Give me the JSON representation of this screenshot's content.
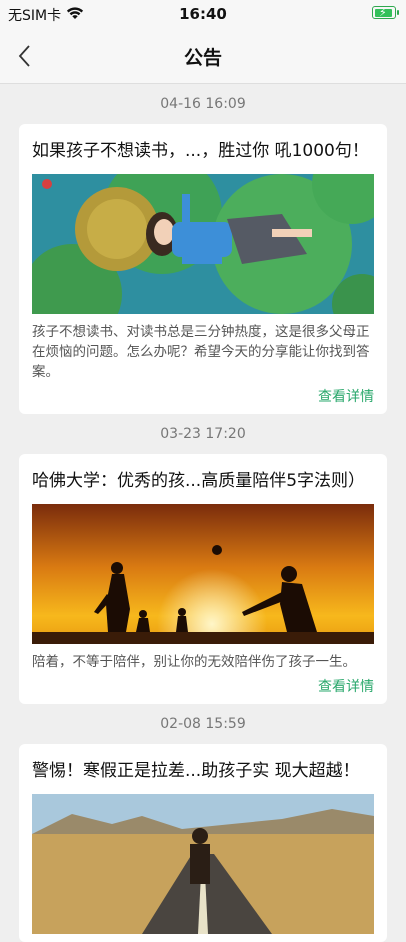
{
  "status_bar": {
    "carrier": "无SIM卡",
    "time": "16:40",
    "icons": [
      "wifi-icon",
      "battery-charging-icon"
    ],
    "battery_color": "#33c05a"
  },
  "nav": {
    "title": "公告",
    "back_icon": "chevron-left-icon"
  },
  "accent_color": "#2aa86c",
  "announcements": [
    {
      "time": "04-16 16:09",
      "title": "如果孩子不想读书，...，胜过你  吼1000句！",
      "image": "girl-lying-on-lily-pads-illustration",
      "description": "孩子不想读书、对读书总是三分钟热度，这是很多父母正在烦恼的问题。怎么办呢？希望今天的分享能让你找到答案。",
      "link": "查看详情"
    },
    {
      "time": "03-23 17:20",
      "title": "哈佛大学：优秀的孩...高质量陪伴5字法则）",
      "image": "family-silhouette-at-sunset",
      "description": "陪着，不等于陪伴，别让你的无效陪伴伤了孩子一生。",
      "link": "查看详情"
    },
    {
      "time": "02-08 15:59",
      "title": "警惕！寒假正是拉差...助孩子实  现大超越！",
      "image": "person-walking-on-desert-road"
    }
  ]
}
